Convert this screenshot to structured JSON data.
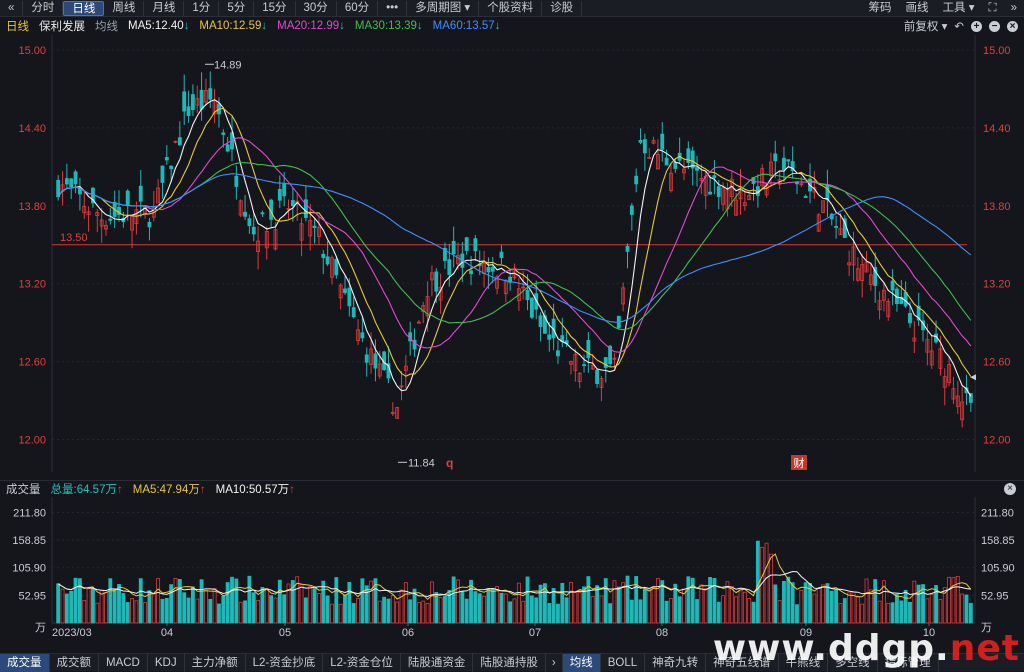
{
  "toolbar": {
    "back_icon": "«",
    "periods": [
      "分时",
      "日线",
      "周线",
      "月线",
      "1分",
      "5分",
      "15分",
      "30分",
      "60分"
    ],
    "active_period": "日线",
    "more": "•••",
    "multi_period": "多周期图",
    "profile": "个股资料",
    "diagnose": "诊股",
    "chip": "筹码",
    "draw": "画线",
    "tools": "工具",
    "fullscreen_icon": "expand-icon",
    "next_icon": "»"
  },
  "infobar": {
    "period": "日线",
    "stock_name": "保利发展",
    "ma_label": "均线",
    "ma5": "MA5:12.40",
    "ma10": "MA10:12.59",
    "ma20": "MA20:12.99",
    "ma30": "MA30:13.39",
    "ma60": "MA60:13.57",
    "down_arrow": "↓",
    "adjust": "前复权"
  },
  "price_axis": {
    "ticks": [
      "15.00",
      "14.40",
      "13.80",
      "13.20",
      "12.60",
      "12.00"
    ],
    "ref_value": "13.50",
    "high_label": "14.89",
    "low_label": "11.84",
    "marker_q": "q",
    "marker_cai": "财"
  },
  "volume_bar": {
    "title": "成交量",
    "total": "总量:64.57万",
    "ma5": "MA5:47.94万",
    "ma10": "MA10:50.57万",
    "up_arrow": "↑",
    "ticks": [
      "211.80",
      "158.85",
      "105.90",
      "52.95",
      "万"
    ]
  },
  "x_axis": {
    "labels": [
      "2023/03",
      "04",
      "05",
      "06",
      "07",
      "08",
      "09",
      "10"
    ]
  },
  "bottom_tabs": {
    "left": [
      "成交量",
      "成交额",
      "MACD",
      "KDJ",
      "主力净额",
      "L2-资金抄底",
      "L2-资金仓位",
      "陆股通资金",
      "陆股通持股"
    ],
    "active_left": "成交量",
    "right": [
      "均线",
      "BOLL",
      "神奇九转",
      "神奇五线谱",
      "牛熊线",
      "多空线",
      "指标管理"
    ],
    "active_right": "均线"
  },
  "watermark": {
    "text_a": "www.ddgp.",
    "text_b": "net"
  },
  "colors": {
    "up": "#e03a3a",
    "down": "#1fb8b8",
    "ma5": "#f2f2f2",
    "ma10": "#e8c83a",
    "ma20": "#e04ad0",
    "ma30": "#3fbf4f",
    "ma60": "#3f8fff",
    "ref_line": "#d23a3a",
    "axis_red": "#e0403a"
  }
}
